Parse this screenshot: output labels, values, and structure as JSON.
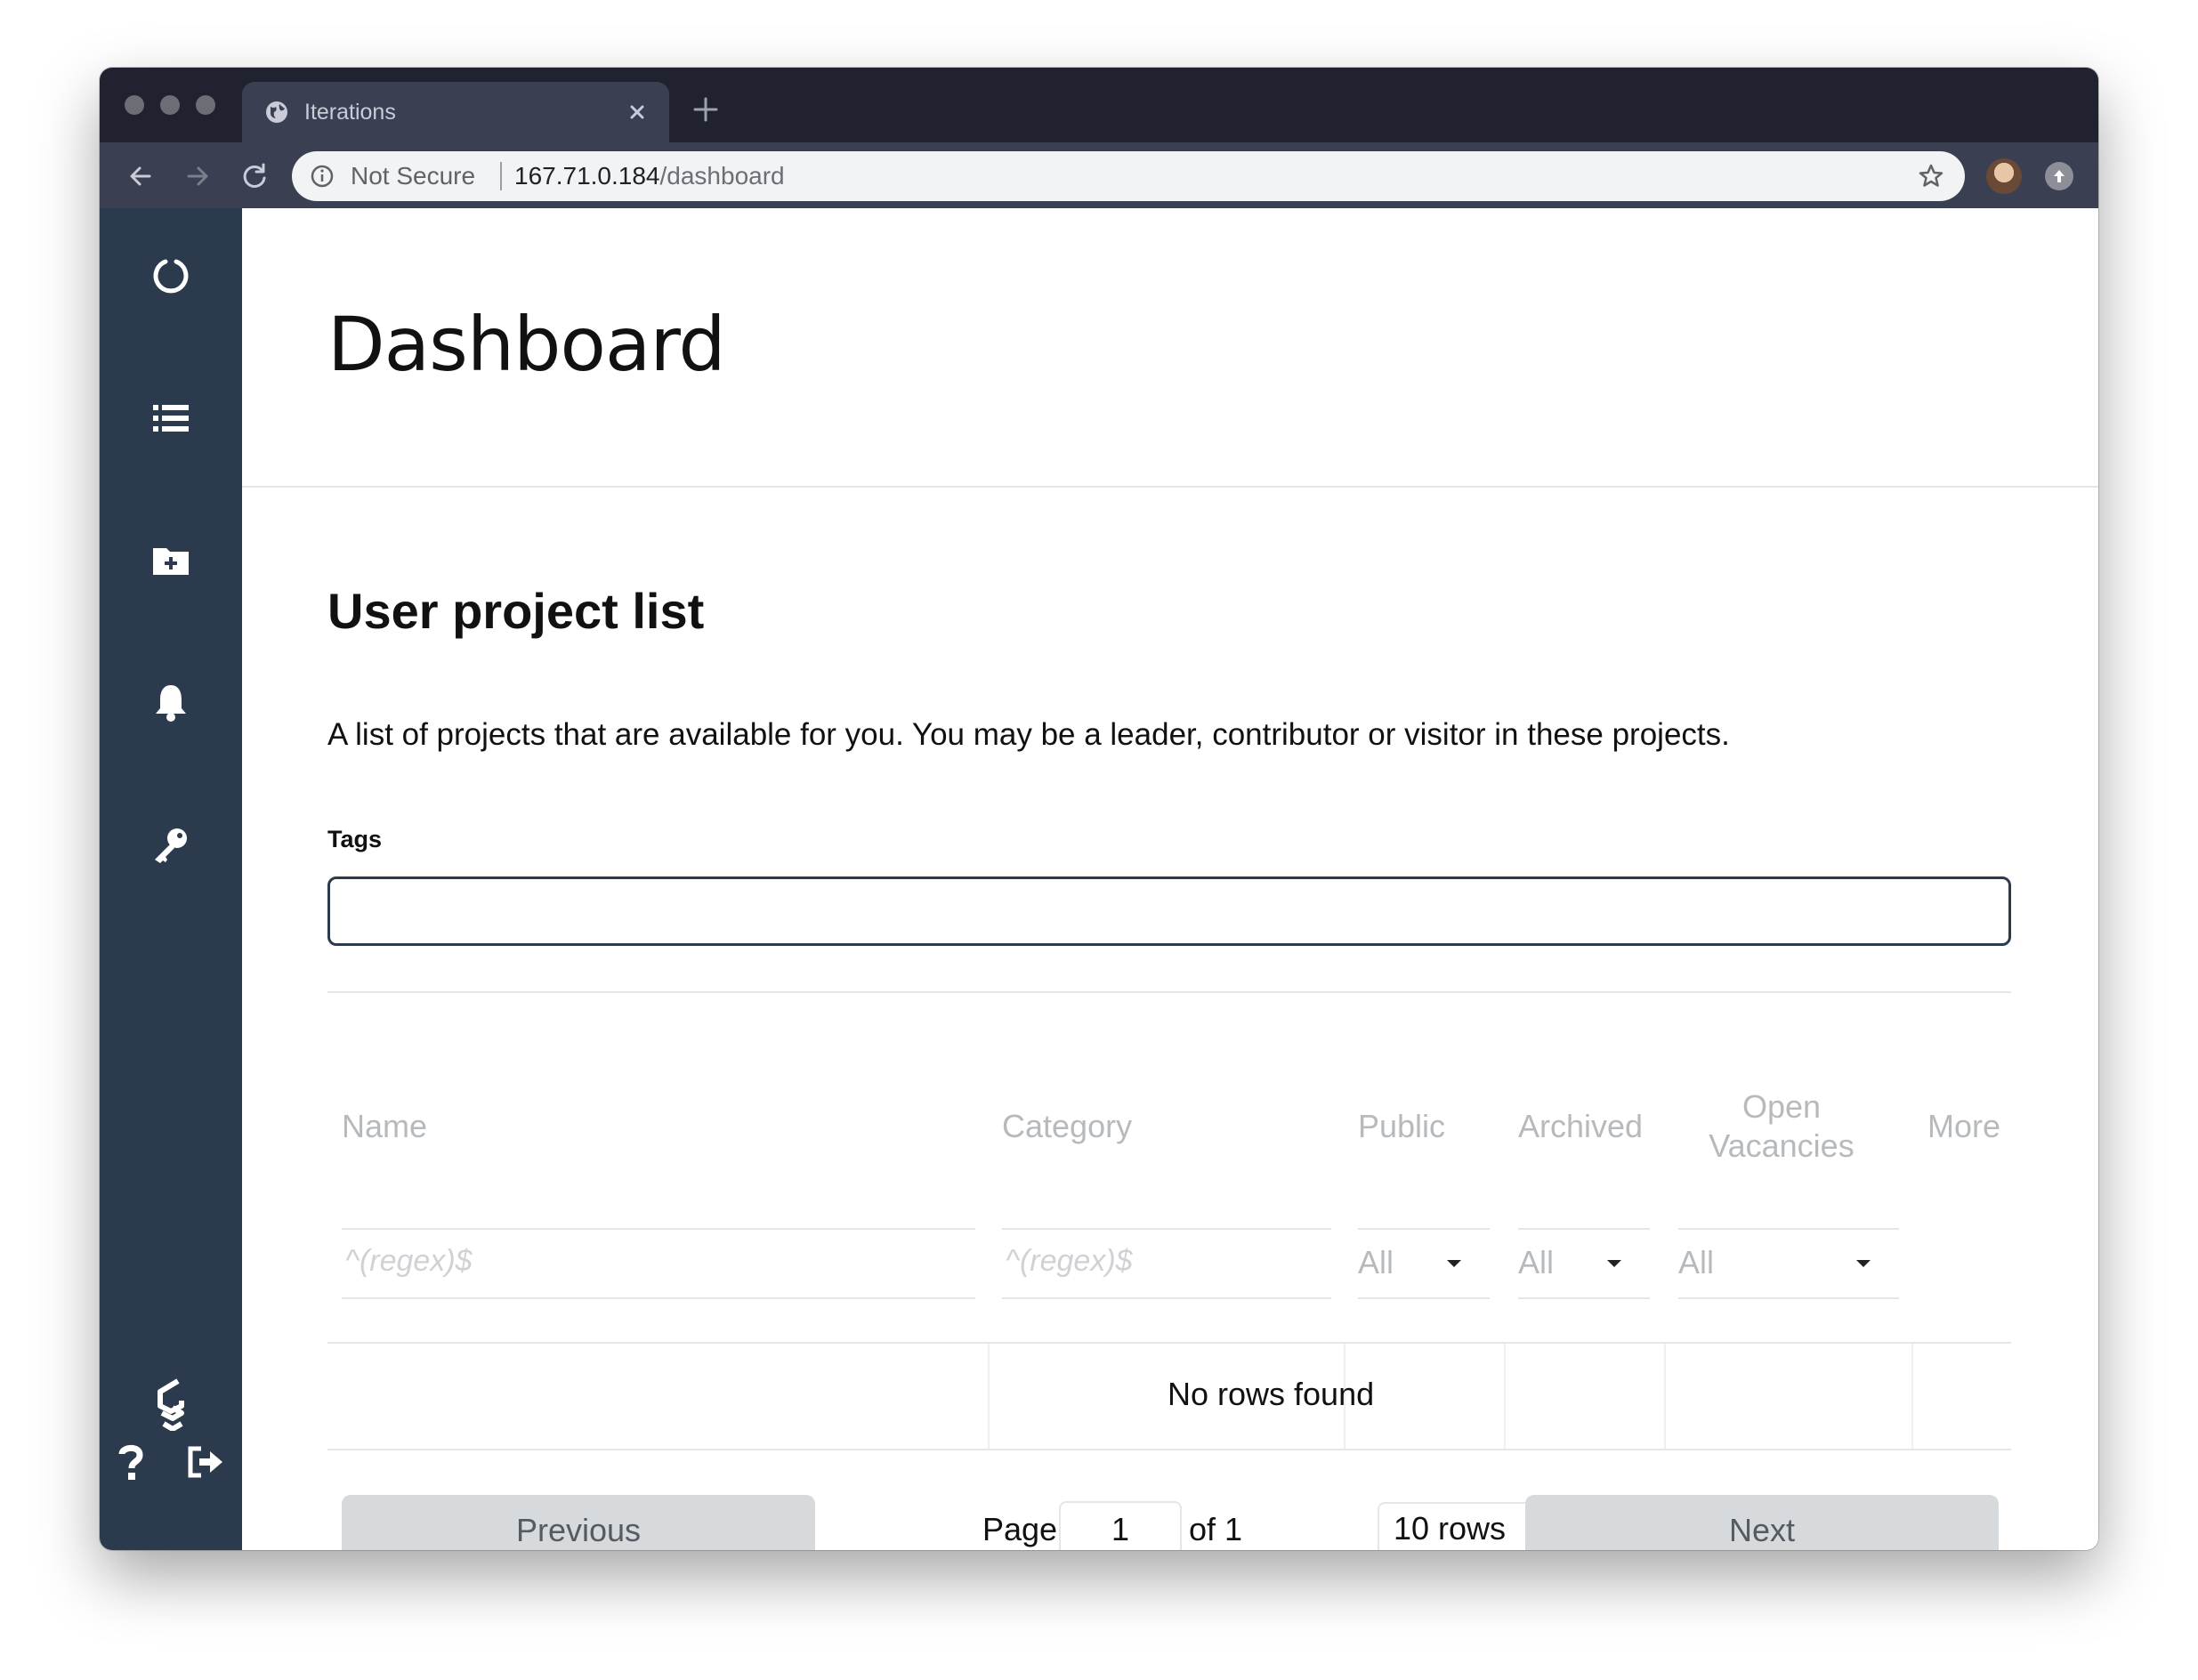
{
  "browser": {
    "tab_title": "Iterations",
    "security_label": "Not Secure",
    "url_host": "167.71.0.184",
    "url_path": "/dashboard"
  },
  "sidebar": {
    "items": [
      {
        "icon": "loading-circle-icon"
      },
      {
        "icon": "list-icon"
      },
      {
        "icon": "folder-plus-icon"
      },
      {
        "icon": "bell-icon"
      },
      {
        "icon": "key-icon"
      }
    ],
    "bottom": [
      {
        "icon": "logo-icon"
      },
      {
        "icon": "help-icon"
      },
      {
        "icon": "logout-icon"
      }
    ]
  },
  "page": {
    "title": "Dashboard",
    "section_title": "User project list",
    "description": "A list of projects that are available for you. You may be a leader, contributor or visitor in these projects.",
    "tags_label": "Tags",
    "tags_value": ""
  },
  "table": {
    "columns": [
      "Name",
      "Category",
      "Public",
      "Archived",
      "Open Vacancies",
      "More"
    ],
    "filters": {
      "name_placeholder": "^(regex)$",
      "category_placeholder": "^(regex)$",
      "public": "All",
      "archived": "All",
      "open_vacancies": "All"
    },
    "empty_message": "No rows found"
  },
  "pagination": {
    "previous_label": "Previous",
    "next_label": "Next",
    "page_label": "Page",
    "current_page": "1",
    "of_label": "of 1",
    "rows_label": "10 rows"
  }
}
